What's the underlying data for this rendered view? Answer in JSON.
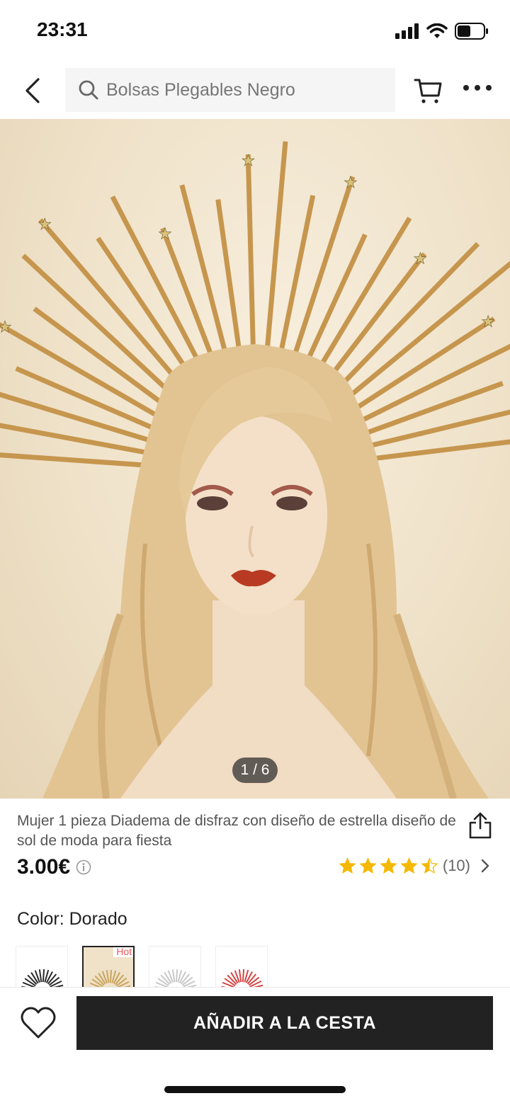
{
  "status_bar": {
    "time": "23:31"
  },
  "header": {
    "search_placeholder": "Bolsas Plegables Negro"
  },
  "gallery": {
    "counter": "1 / 6"
  },
  "product": {
    "title": "Mujer 1 pieza Diadema de disfraz con diseño de estrella diseño de sol de moda para fiesta",
    "price": "3.00€",
    "rating": 4.5,
    "review_count": "(10)",
    "color_label": "Color: Dorado",
    "swatches": [
      {
        "name": "black",
        "color": "#2a2a2a"
      },
      {
        "name": "gold",
        "color": "#c9a45c",
        "badge": "Hot"
      },
      {
        "name": "silver",
        "color": "#c8c8c8"
      },
      {
        "name": "red",
        "color": "#d64545"
      }
    ]
  },
  "bottom_bar": {
    "add_to_cart_label": "AÑADIR A LA CESTA"
  },
  "colors": {
    "star": "#f5b800",
    "button": "#222222",
    "hot": "#e55555"
  }
}
